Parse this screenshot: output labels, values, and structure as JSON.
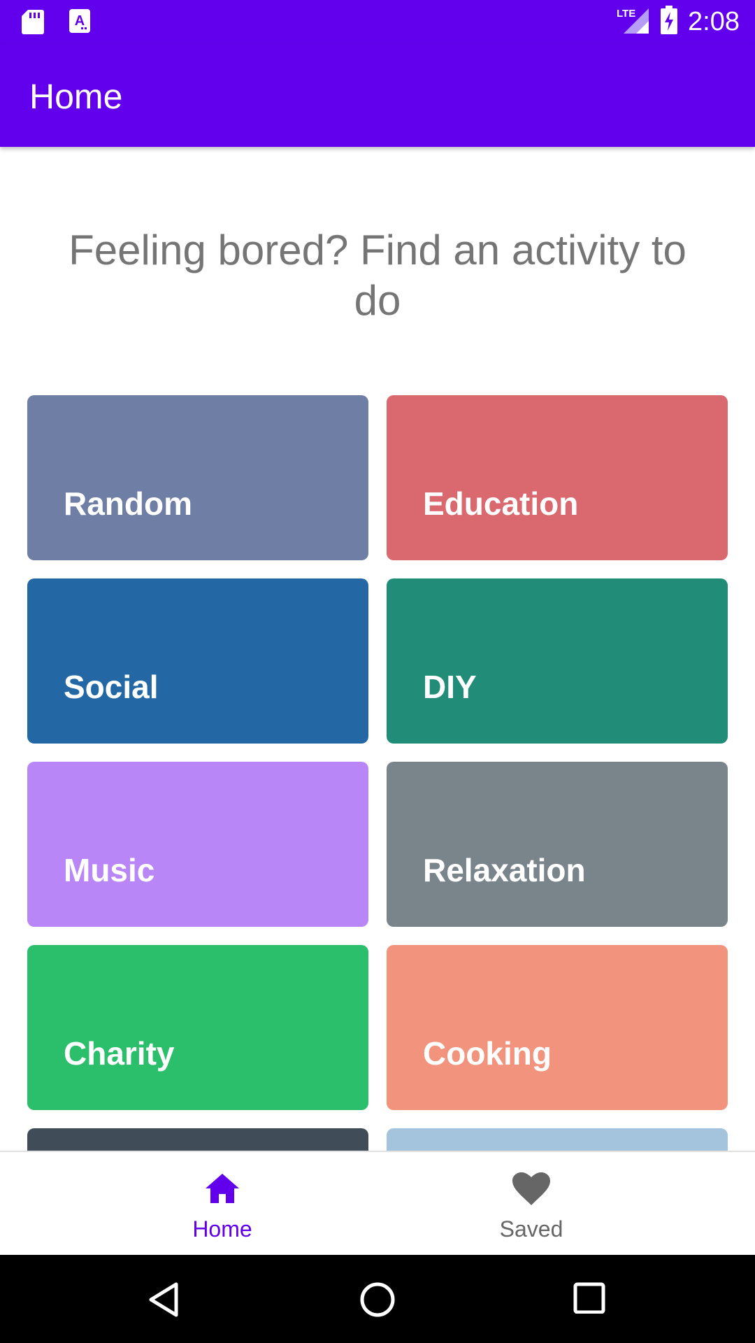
{
  "status_bar": {
    "time": "2:08",
    "icons": [
      "sd-card-icon",
      "app-notification-icon",
      "lte-signal-icon",
      "battery-charging-icon"
    ]
  },
  "app_bar": {
    "title": "Home"
  },
  "headline": "Feeling bored? Find an activity to do",
  "categories": [
    {
      "label": "Random",
      "color": "#6f7ea5"
    },
    {
      "label": "Education",
      "color": "#da686f"
    },
    {
      "label": "Social",
      "color": "#2368a5"
    },
    {
      "label": "DIY",
      "color": "#218c78"
    },
    {
      "label": "Music",
      "color": "#b986f8"
    },
    {
      "label": "Relaxation",
      "color": "#79858b"
    },
    {
      "label": "Charity",
      "color": "#2bbf6b"
    },
    {
      "label": "Cooking",
      "color": "#f1937d"
    },
    {
      "label": "",
      "color": "#404c58"
    },
    {
      "label": "",
      "color": "#a3c4dc"
    }
  ],
  "bottom_nav": {
    "home_label": "Home",
    "saved_label": "Saved",
    "active_color": "#6200ee",
    "inactive_color": "#666666"
  },
  "system_nav": {
    "icons": [
      "back-icon",
      "home-circle-icon",
      "recents-icon"
    ]
  },
  "colors": {
    "primary": "#6200ee"
  }
}
